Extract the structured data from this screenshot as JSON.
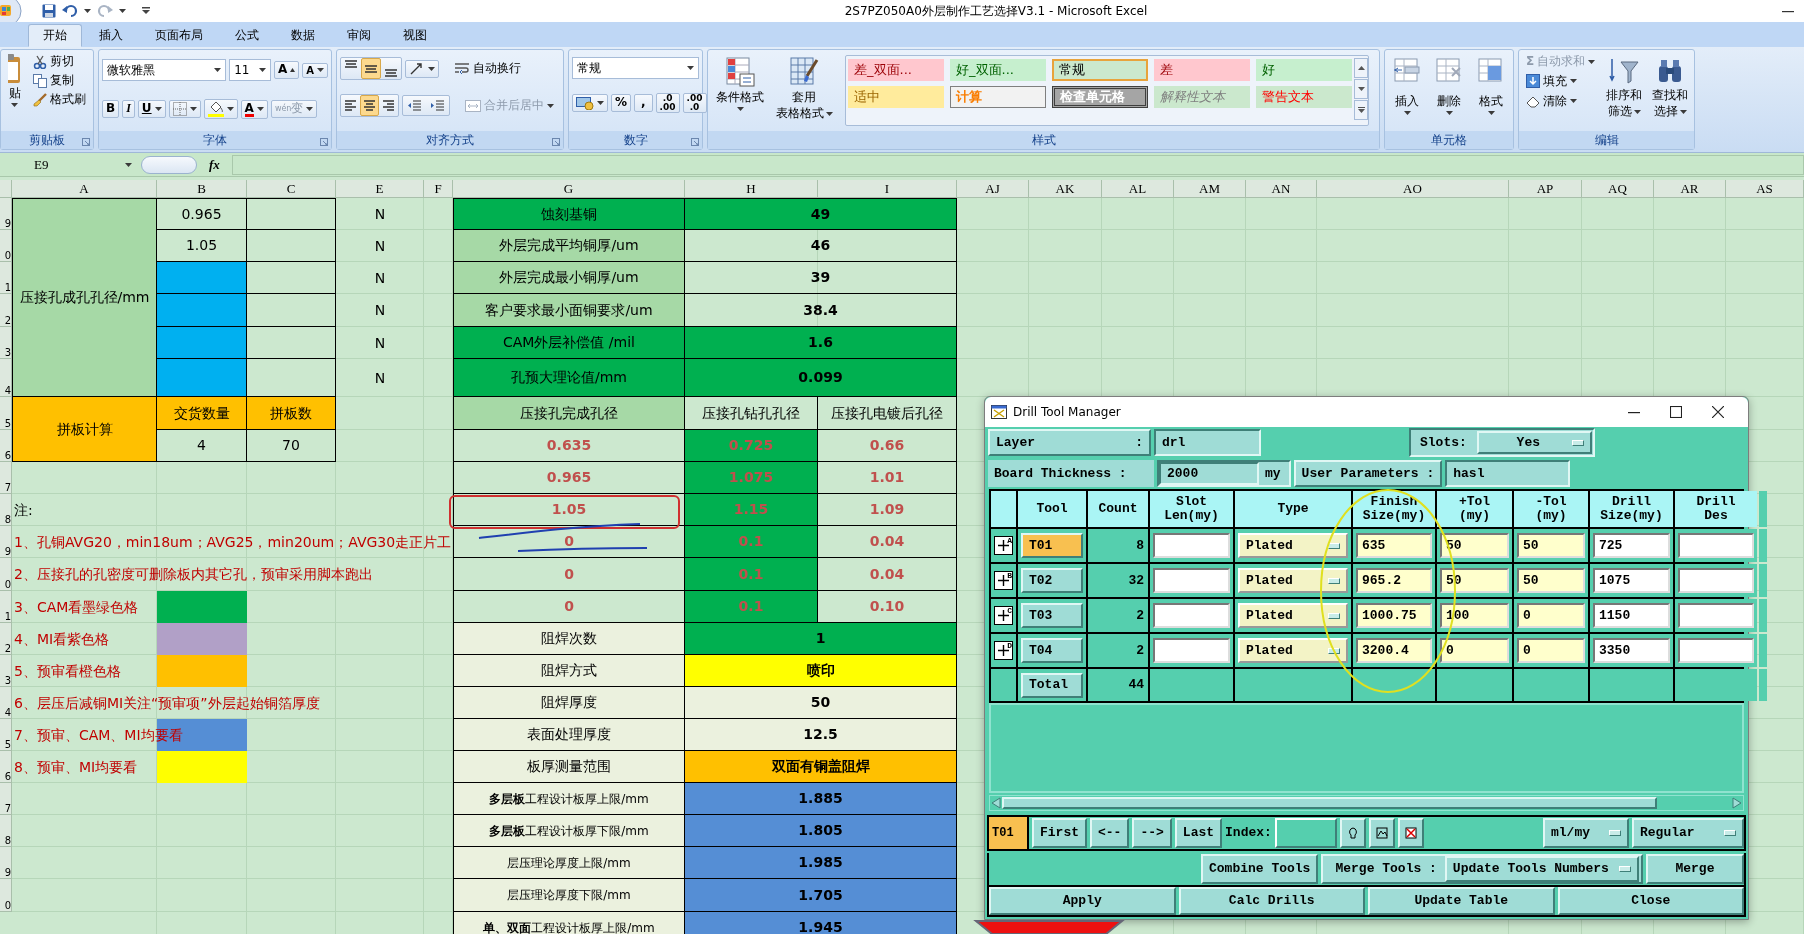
{
  "window": {
    "title": "2S7PZ050A0外层制作工艺选择V3.1 - Microsoft Excel"
  },
  "ribbon_tabs": [
    {
      "label": "开始",
      "selected": true
    },
    {
      "label": "插入",
      "selected": false
    },
    {
      "label": "页面布局",
      "selected": false
    },
    {
      "label": "公式",
      "selected": false
    },
    {
      "label": "数据",
      "selected": false
    },
    {
      "label": "审阅",
      "selected": false
    },
    {
      "label": "视图",
      "selected": false
    }
  ],
  "clipboard": {
    "paste": "贴",
    "cut": "剪切",
    "copy": "复制",
    "painter": "格式刷",
    "title": "剪贴板"
  },
  "font": {
    "family": "微软雅黑",
    "size": "11",
    "grow": "A",
    "shrink": "A",
    "bold": "B",
    "italic": "I",
    "underline": "U",
    "font_color": "A",
    "phonetic": "wén",
    "phonetic_char": "变",
    "title": "字体"
  },
  "alignment": {
    "vertical": [
      {
        "selected": false
      },
      {
        "selected": true
      },
      {
        "selected": false
      }
    ],
    "horizontal": [
      {
        "selected": false
      },
      {
        "selected": true
      },
      {
        "selected": false
      }
    ],
    "wrap": {
      "label": "自动换行",
      "disabled": false
    },
    "merge": {
      "label": "合并后居中",
      "disabled": true
    },
    "title": "对齐方式"
  },
  "number": {
    "format": "常规",
    "percent": "%",
    "comma": ",",
    "increase_decimal": [
      ".0",
      ".00"
    ],
    "decrease_decimal": [
      ".00",
      ".0"
    ],
    "title": "数字"
  },
  "styles": {
    "conditional": "条件格式",
    "table_format": [
      "套用",
      "表格格式"
    ],
    "title": "样式",
    "gallery": [
      {
        "text": "差_双面...",
        "kind": "bad",
        "selected": false
      },
      {
        "text": "好_双面...",
        "kind": "good",
        "selected": false
      },
      {
        "text": "常规",
        "kind": "normal",
        "selected": true
      },
      {
        "text": "差",
        "kind": "bad",
        "selected": false
      },
      {
        "text": "好",
        "kind": "good",
        "selected": false
      },
      {
        "text": "适中",
        "kind": "neutral",
        "selected": false
      },
      {
        "text": "计算",
        "kind": "calculation",
        "selected": false
      },
      {
        "text": "检查单元格",
        "kind": "check",
        "selected": false
      },
      {
        "text": "解释性文本",
        "kind": "explanatory",
        "selected": false
      },
      {
        "text": "警告文本",
        "kind": "warning",
        "selected": false
      }
    ]
  },
  "cells": {
    "insert": "插入",
    "delete": "删除",
    "format": "格式",
    "title": "单元格"
  },
  "editing": {
    "autosum": {
      "icon": "Σ",
      "label": "自动求和",
      "disabled": true
    },
    "fill": "填充",
    "clear": "清除",
    "sort": [
      "排序和",
      "筛选"
    ],
    "find": [
      "查找和",
      "选择"
    ],
    "title": "编辑"
  },
  "formula_bar": {
    "cell": "E9",
    "fx": "fx"
  },
  "sheet": {
    "columns": [
      "A",
      "B",
      "C",
      "E",
      "F",
      "G",
      "H",
      "I",
      "AJ",
      "AK",
      "AL",
      "AM",
      "AN",
      "AO",
      "AP",
      "AQ",
      "AR",
      "AS"
    ],
    "row_numbers": [
      "9",
      "0",
      "1",
      "2",
      "3",
      "4",
      "5",
      "6",
      "7",
      "8",
      "9",
      "0",
      "1",
      "2",
      "3",
      "4",
      "5",
      "6",
      "7",
      "8",
      "9",
      "0"
    ],
    "left_block": {
      "label": "压接孔成孔孔径/mm",
      "color": "#a6d9a6",
      "values": [
        {
          "text": "0.965"
        },
        {
          "text": "1.05"
        },
        {
          "color": "#00b0f0"
        },
        {
          "color": "#00b0f0"
        },
        {
          "color": "#00b0f0"
        },
        {
          "color": "#00b0f0"
        }
      ],
      "flags": [
        "N",
        "N",
        "N",
        "N",
        "N",
        "N"
      ]
    },
    "panel_calc": {
      "label": "拼板计算",
      "color": "#ffc000",
      "headers": [
        "交货数量",
        "拼板数"
      ],
      "values": [
        "4",
        "70"
      ]
    },
    "notes": {
      "title": "注:",
      "items": [
        {
          "text": "1、孔铜AVG20，min18um；AVG25，min20um；AVG30走正片工"
        },
        {
          "text": "2、压接孔的孔密度可删除板内其它孔，预审采用脚本跑出"
        },
        {
          "text": "3、CAM看墨绿色格",
          "color": "#00b050"
        },
        {
          "text": "4、MI看紫色格",
          "color": "#b1a0c7"
        },
        {
          "text": "5、预审看橙色格",
          "color": "#ffc000"
        },
        {
          "text": "6、层压后减铜MI关注“预审项”外层起始铜箔厚度"
        },
        {
          "text": "7、预审、CAM、MI均要看",
          "color": "#558ed5"
        },
        {
          "text": "8、预审、MI均要看",
          "color": "#ffff00"
        }
      ]
    },
    "params": [
      {
        "kind": "pair",
        "cells": [
          {
            "text": "蚀刻基铜",
            "color": "#00b050"
          },
          {
            "text": "49",
            "color": "#00b050"
          }
        ]
      },
      {
        "kind": "pair",
        "cells": [
          {
            "text": "外层完成平均铜厚/um",
            "color": "#a6d9a6"
          },
          {
            "text": "46"
          }
        ]
      },
      {
        "kind": "pair",
        "cells": [
          {
            "text": "外层完成最小铜厚/um",
            "color": "#a6d9a6"
          },
          {
            "text": "39"
          }
        ]
      },
      {
        "kind": "pair",
        "cells": [
          {
            "text": "客户要求最小面铜要求/um",
            "color": "#a6d9a6"
          },
          {
            "text": "38.4"
          }
        ]
      },
      {
        "kind": "pair",
        "cells": [
          {
            "text": "CAM外层补偿值 /mil",
            "color": "#00b050"
          },
          {
            "text": "1.6",
            "color": "#00b050"
          }
        ]
      },
      {
        "kind": "pair",
        "cells": [
          {
            "text": "孔预大理论值/mm",
            "color": "#00b050"
          },
          {
            "text": "0.099",
            "color": "#00b050"
          }
        ]
      },
      {
        "kind": "header",
        "cells": [
          {
            "text": "压接孔完成孔径",
            "color": "#a6d9a6"
          },
          {
            "text": "压接孔钻孔孔径"
          },
          {
            "text": "压接孔电镀后孔径"
          }
        ]
      },
      {
        "kind": "triple",
        "cells": [
          {
            "text": "0.635"
          },
          {
            "text": "0.725",
            "color": "#00b050"
          },
          {
            "text": "0.66"
          }
        ]
      },
      {
        "kind": "triple",
        "cells": [
          {
            "text": "0.965"
          },
          {
            "text": "1.075",
            "color": "#00b050"
          },
          {
            "text": "1.01"
          }
        ]
      },
      {
        "kind": "triple",
        "cells": [
          {
            "text": "1.05"
          },
          {
            "text": "1.15",
            "color": "#00b050"
          },
          {
            "text": "1.09"
          }
        ]
      },
      {
        "kind": "triple",
        "cells": [
          {
            "text": "0"
          },
          {
            "text": "0.1",
            "color": "#00b050"
          },
          {
            "text": "0.04"
          }
        ]
      },
      {
        "kind": "triple",
        "cells": [
          {
            "text": "0"
          },
          {
            "text": "0.1",
            "color": "#00b050"
          },
          {
            "text": "0.04"
          }
        ]
      },
      {
        "kind": "triple",
        "cells": [
          {
            "text": "0"
          },
          {
            "text": "0.1",
            "color": "#00b050"
          },
          {
            "text": "0.10"
          }
        ]
      },
      {
        "kind": "pair",
        "cells": [
          {
            "text": "阻焊次数",
            "color": "#ebf1de"
          },
          {
            "text": "1",
            "color": "#00b050"
          }
        ]
      },
      {
        "kind": "pair",
        "cells": [
          {
            "text": "阻焊方式",
            "color": "#ebf1de"
          },
          {
            "text": "喷印",
            "color": "#ffff00"
          }
        ]
      },
      {
        "kind": "pair",
        "cells": [
          {
            "text": "阻焊厚度",
            "color": "#ebf1de"
          },
          {
            "text": "50",
            "color": "#ebf1de"
          }
        ]
      },
      {
        "kind": "pair",
        "cells": [
          {
            "text": "表面处理厚度",
            "color": "#ebf1de"
          },
          {
            "text": "12.5",
            "color": "#ebf1de"
          }
        ]
      },
      {
        "kind": "pair",
        "cells": [
          {
            "text": "板厚测量范围",
            "color": "#ebf1de"
          },
          {
            "text": "双面有铜盖阻焊",
            "color": "#ffc000"
          }
        ]
      },
      {
        "kind": "spec",
        "cells": [
          {
            "text": "**多层板**工程设计板厚上限/mm",
            "color": "#ebf1de"
          },
          {
            "text": "1.885",
            "color": "#558ed5"
          }
        ]
      },
      {
        "kind": "spec",
        "cells": [
          {
            "text": "**多层板**工程设计板厚下限/mm",
            "color": "#ebf1de"
          },
          {
            "text": "1.805",
            "color": "#558ed5"
          }
        ]
      },
      {
        "kind": "spec",
        "cells": [
          {
            "text": "层压理论厚度上限/mm",
            "color": "#ebf1de"
          },
          {
            "text": "1.985",
            "color": "#558ed5"
          }
        ]
      },
      {
        "kind": "spec",
        "cells": [
          {
            "text": "层压理论厚度下限/mm",
            "color": "#ebf1de"
          },
          {
            "text": "1.705",
            "color": "#558ed5"
          }
        ]
      },
      {
        "kind": "spec",
        "cells": [
          {
            "text": "**单、双面**工程设计板厚上限/mm",
            "color": "#ebf1de"
          },
          {
            "text": "1.945",
            "color": "#558ed5"
          }
        ]
      }
    ]
  },
  "dialog": {
    "title": "Drill Tool Manager",
    "layer": {
      "label": "Layer",
      "separator": ":",
      "value": "drl"
    },
    "slots": {
      "label": "Slots:",
      "value": "Yes"
    },
    "thickness": {
      "label": "Board Thickness :",
      "value": "2000",
      "unit": "my"
    },
    "user_parameters": {
      "label": "User Parameters :",
      "value": "hasl"
    },
    "columns": [
      {
        "lines": [
          "Tool"
        ]
      },
      {
        "lines": [
          "Count"
        ]
      },
      {
        "lines": [
          "Slot",
          "Len(my)"
        ]
      },
      {
        "lines": [
          "Type"
        ]
      },
      {
        "lines": [
          "Finish",
          "Size(my)"
        ]
      },
      {
        "lines": [
          "+Tol",
          "(my)"
        ]
      },
      {
        "lines": [
          "-Tol",
          "(my)"
        ]
      },
      {
        "lines": [
          "Drill",
          "Size(my)"
        ]
      },
      {
        "lines": [
          "Drill",
          "Des"
        ]
      }
    ],
    "tools": [
      {
        "marker": "A",
        "tool": "T01",
        "selected": true,
        "count": "8",
        "type": "Plated",
        "finish": "635",
        "plus_tol": "50",
        "minus_tol": "50",
        "drill": "725"
      },
      {
        "marker": "B",
        "tool": "T02",
        "selected": false,
        "count": "32",
        "type": "Plated",
        "finish": "965.2",
        "plus_tol": "50",
        "minus_tol": "50",
        "drill": "1075"
      },
      {
        "marker": "C",
        "tool": "T03",
        "selected": false,
        "count": "2",
        "type": "Plated",
        "finish": "1000.75",
        "plus_tol": "100",
        "minus_tol": "0",
        "drill": "1150"
      },
      {
        "marker": "D",
        "tool": "T04",
        "selected": false,
        "count": "2",
        "type": "Plated",
        "finish": "3200.4",
        "plus_tol": "0",
        "minus_tol": "0",
        "drill": "3350"
      }
    ],
    "total": {
      "label": "Total",
      "count": "44"
    },
    "nav": {
      "current": "T01",
      "buttons": [
        "First",
        "<--",
        "-->",
        "Last"
      ],
      "index_label": "Index:",
      "units": "ml/my",
      "mode": "Regular"
    },
    "merge": {
      "combine": "Combine Tools",
      "label": "Merge Tools :",
      "option": "Update Tools Numbers",
      "button": "Merge"
    },
    "actions": [
      "Apply",
      "Calc Drills",
      "Update Table",
      "Close"
    ]
  }
}
